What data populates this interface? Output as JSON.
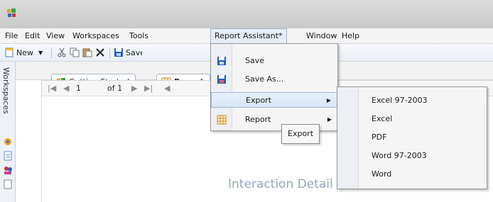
{
  "menubar": {
    "items": [
      "File",
      "Edit",
      "View",
      "Workspaces",
      "Tools",
      "Report Assistant*",
      "Window",
      "Help"
    ]
  },
  "toolbar": {
    "new_label": "New",
    "save_label": "Save"
  },
  "sidebar": {
    "label": "Workspaces"
  },
  "tabs": [
    {
      "label": "Getting Started"
    },
    {
      "label": "Report"
    }
  ],
  "navigator": {
    "page_current": "1",
    "page_total_text": "of 1"
  },
  "report": {
    "heading": "Interaction Detail"
  },
  "report_assistant_menu": {
    "items": [
      {
        "label": "Save"
      },
      {
        "label": "Save As..."
      },
      {
        "label": "Export"
      },
      {
        "label": "Report"
      }
    ]
  },
  "tooltip": {
    "text": "Export"
  },
  "export_submenu": {
    "items": [
      "Excel 97-2003",
      "Excel",
      "PDF",
      "Word 97-2003",
      "Word"
    ]
  },
  "colors": {
    "menu_highlight": "#d7e6f6",
    "report_heading": "#8fa7bf",
    "save_icon": "#1f5fbf"
  }
}
